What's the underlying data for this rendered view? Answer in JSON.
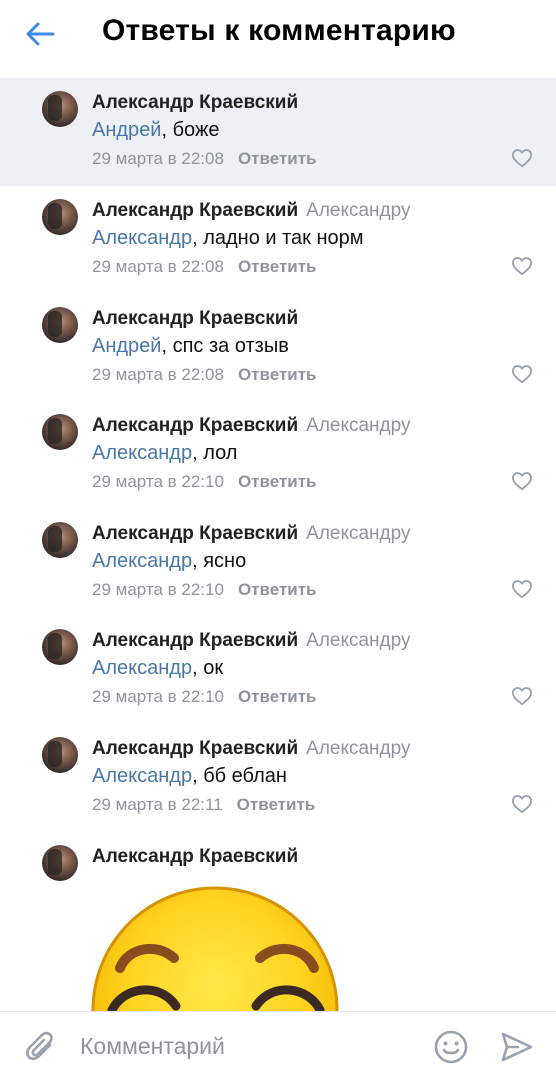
{
  "header": {
    "title": "Ответы к комментарию",
    "back_icon": "arrow-left-icon"
  },
  "comments": [
    {
      "author": "Александр Краевский",
      "reply_to": "",
      "mention": "Андрей",
      "text": ", боже",
      "time": "29 марта в 22:08",
      "reply_label": "Ответить",
      "highlighted": true
    },
    {
      "author": "Александр Краевский",
      "reply_to": "Александру",
      "mention": "Александр",
      "text": ", ладно и так норм",
      "time": "29 марта в 22:08",
      "reply_label": "Ответить"
    },
    {
      "author": "Александр Краевский",
      "reply_to": "",
      "mention": "Андрей",
      "text": ", спс за отзыв",
      "time": "29 марта в 22:08",
      "reply_label": "Ответить"
    },
    {
      "author": "Александр Краевский",
      "reply_to": "Александру",
      "mention": "Александр",
      "text": ", лол",
      "time": "29 марта в 22:10",
      "reply_label": "Ответить"
    },
    {
      "author": "Александр Краевский",
      "reply_to": "Александру",
      "mention": "Александр",
      "text": ", ясно",
      "time": "29 марта в 22:10",
      "reply_label": "Ответить"
    },
    {
      "author": "Александр Краевский",
      "reply_to": "Александру",
      "mention": "Александр",
      "text": ", ок",
      "time": "29 марта в 22:10",
      "reply_label": "Ответить"
    },
    {
      "author": "Александр Краевский",
      "reply_to": "Александру",
      "mention": "Александр",
      "text": ", бб еблан",
      "time": "29 марта в 22:11",
      "reply_label": "Ответить"
    },
    {
      "author": "Александр Краевский",
      "sticker": "smiling-emoji-sticker"
    }
  ],
  "composer": {
    "placeholder": "Комментарий",
    "attach_icon": "paperclip-icon",
    "emoji_icon": "smile-icon",
    "send_icon": "send-icon"
  },
  "colors": {
    "accent": "#4a76a8",
    "secondary_text": "#8f949a",
    "highlight_bg": "#edf0f5",
    "back_arrow": "#3f8ae0"
  }
}
